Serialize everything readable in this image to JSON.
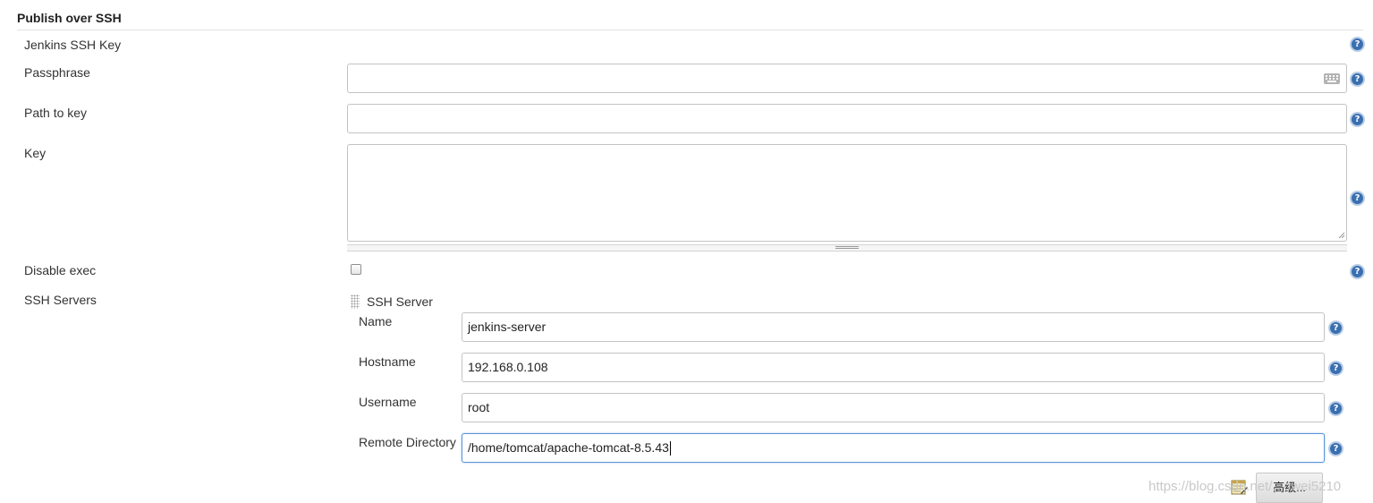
{
  "section": {
    "title": "Publish over SSH"
  },
  "fields": {
    "jenkins_ssh_key": {
      "label": "Jenkins SSH Key"
    },
    "passphrase": {
      "label": "Passphrase",
      "value": ""
    },
    "path_to_key": {
      "label": "Path to key",
      "value": ""
    },
    "key": {
      "label": "Key",
      "value": ""
    },
    "disable_exec": {
      "label": "Disable exec",
      "checked": false
    }
  },
  "ssh_servers": {
    "label": "SSH Servers",
    "server": {
      "title": "SSH Server",
      "name": {
        "label": "Name",
        "value": "jenkins-server"
      },
      "hostname": {
        "label": "Hostname",
        "value": "192.168.0.108"
      },
      "username": {
        "label": "Username",
        "value": "root"
      },
      "remote_directory": {
        "label": "Remote Directory",
        "value": "/home/tomcat/apache-tomcat-8.5.43"
      }
    },
    "advanced_button": {
      "label": "高级..."
    }
  },
  "help_icon_glyph": "?",
  "watermark": "https://blog.csdn.net/...owei5210",
  "colors": {
    "help_icon": "#3a6fb0",
    "focus_border": "#5d95d9"
  }
}
